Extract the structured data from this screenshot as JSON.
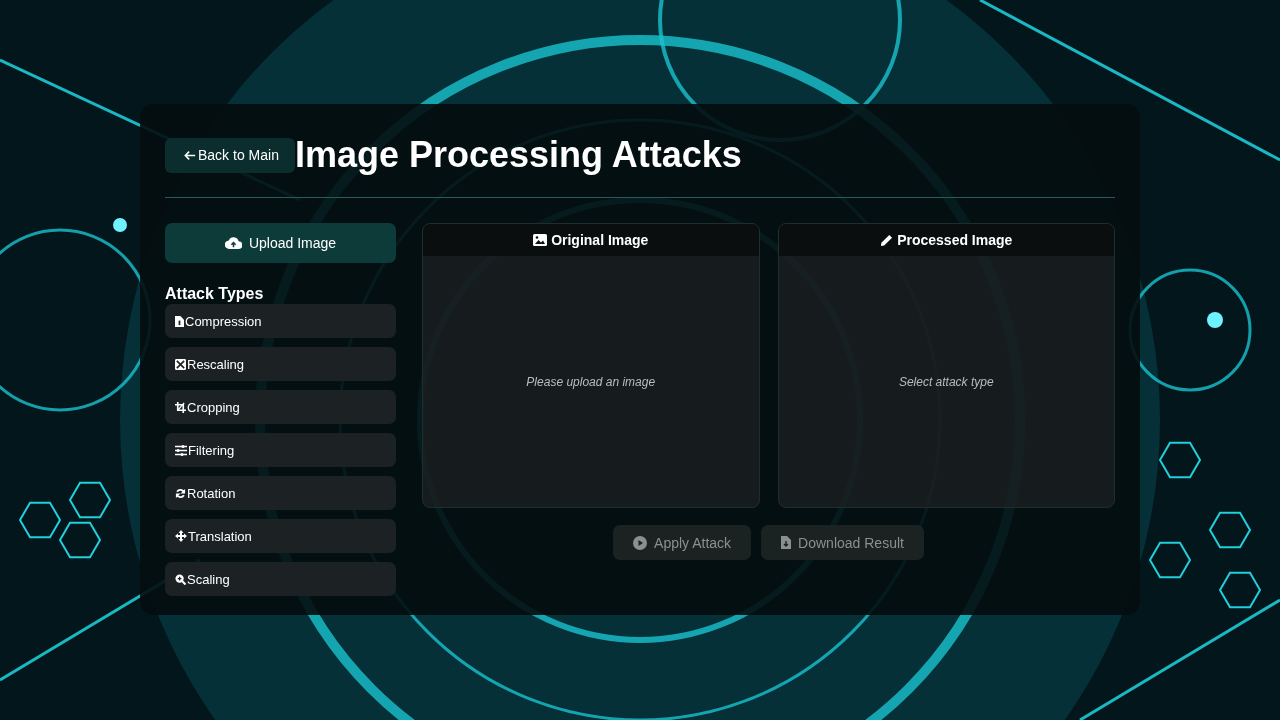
{
  "back_button": {
    "label": "Back to Main"
  },
  "title": "Image Processing Attacks",
  "upload_button": {
    "label": "Upload Image"
  },
  "attack_types": {
    "heading": "Attack Types",
    "items": [
      {
        "label": "Compression"
      },
      {
        "label": "Rescaling"
      },
      {
        "label": "Cropping"
      },
      {
        "label": "Filtering"
      },
      {
        "label": "Rotation"
      },
      {
        "label": "Translation"
      },
      {
        "label": "Scaling"
      }
    ]
  },
  "panels": [
    {
      "title": "Original Image",
      "message": "Please upload an image"
    },
    {
      "title": "Processed Image",
      "message": "Select attack type"
    }
  ],
  "actions": [
    {
      "label": "Apply Attack",
      "disabled": true
    },
    {
      "label": "Download Result",
      "disabled": true
    }
  ]
}
